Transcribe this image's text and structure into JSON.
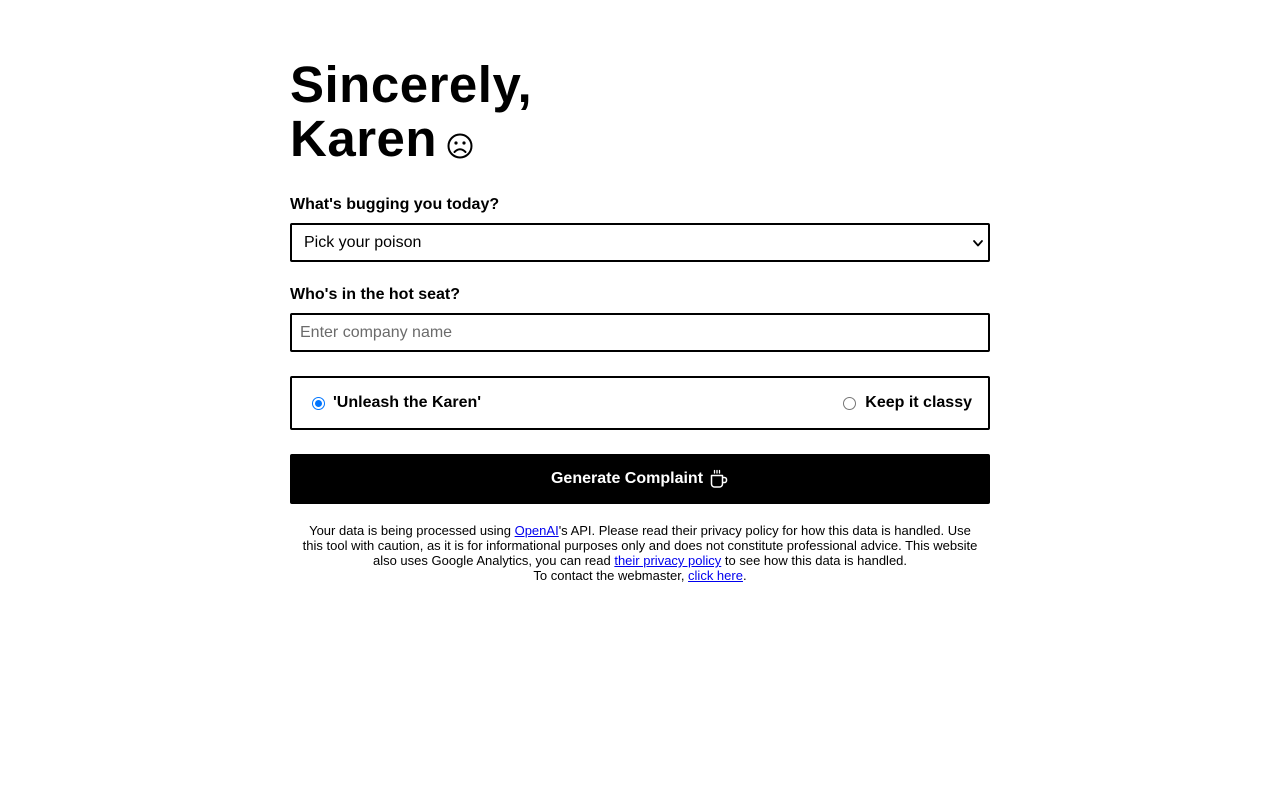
{
  "header": {
    "title_line1": "Sincerely,",
    "title_line2": "Karen",
    "title_icon": "frown-face-icon"
  },
  "form": {
    "issue_label": "What's bugging you today?",
    "issue_select": {
      "selected": "Pick your poison"
    },
    "company_label": "Who's in the hot seat?",
    "company_input": {
      "value": "",
      "placeholder": "Enter company name"
    },
    "tone": {
      "options": [
        {
          "label": "'Unleash the Karen'",
          "checked": true
        },
        {
          "label": "Keep it classy",
          "checked": false
        }
      ]
    },
    "generate_button": {
      "label": "Generate Complaint",
      "icon": "coffee-mug-icon"
    }
  },
  "footer": {
    "part1": "Your data is being processed using ",
    "openai_link": "OpenAI",
    "part2": "'s API. Please read their privacy policy for how this data is handled. Use this tool with caution, as it is for informational purposes only and does not constitute professional advice. This website also uses Google Analytics, you can read ",
    "privacy_link": "their privacy policy",
    "part3": " to see how this data is handled.",
    "contact_text": "To contact the webmaster, ",
    "contact_link": "click here",
    "contact_end": "."
  },
  "colors": {
    "accent": "#0075ff",
    "button_bg": "#000000",
    "link": "#0000ee"
  }
}
